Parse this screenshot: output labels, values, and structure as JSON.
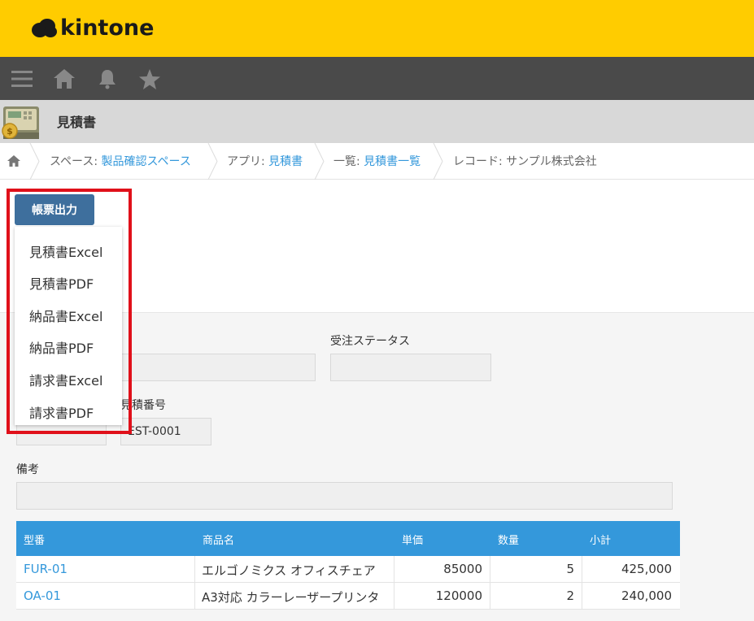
{
  "brand": {
    "name": "kintone"
  },
  "nav": {
    "icons": [
      "menu-icon",
      "home-icon",
      "bell-icon",
      "star-icon"
    ]
  },
  "app": {
    "title": "見積書"
  },
  "breadcrumb": {
    "space_prefix": "スペース: ",
    "space": "製品確認スペース",
    "app_prefix": "アプリ: ",
    "app": "見積書",
    "list_prefix": "一覧: ",
    "list": "見積書一覧",
    "record": "レコード: サンプル株式会社"
  },
  "toolbar": {
    "print_label": "帳票出力"
  },
  "dropdown": {
    "items": [
      "見積書Excel",
      "見積書PDF",
      "納品書Excel",
      "納品書PDF",
      "請求書Excel",
      "請求書PDF"
    ]
  },
  "form": {
    "order_status_label": "受注ステータス",
    "order_status_value": "",
    "partial_value_1": "",
    "estimate_no_label": "見積番号",
    "estimate_no_value": "EST-0001",
    "notes_label": "備考",
    "notes_value": ""
  },
  "table": {
    "headers": [
      "型番",
      "商品名",
      "単価",
      "数量",
      "小計"
    ],
    "rows": [
      [
        "FUR-01",
        "エルゴノミクス オフィスチェア",
        "85000",
        "5",
        "425,000"
      ],
      [
        "OA-01",
        "A3対応 カラーレーザープリンタ",
        "120000",
        "2",
        "240,000"
      ]
    ]
  },
  "colors": {
    "brand_yellow": "#ffcc00",
    "nav_dark": "#4a4a4a",
    "button_blue": "#3e6f9d",
    "table_header": "#3498db",
    "link": "#3498db",
    "highlight_red": "#e0101a"
  }
}
